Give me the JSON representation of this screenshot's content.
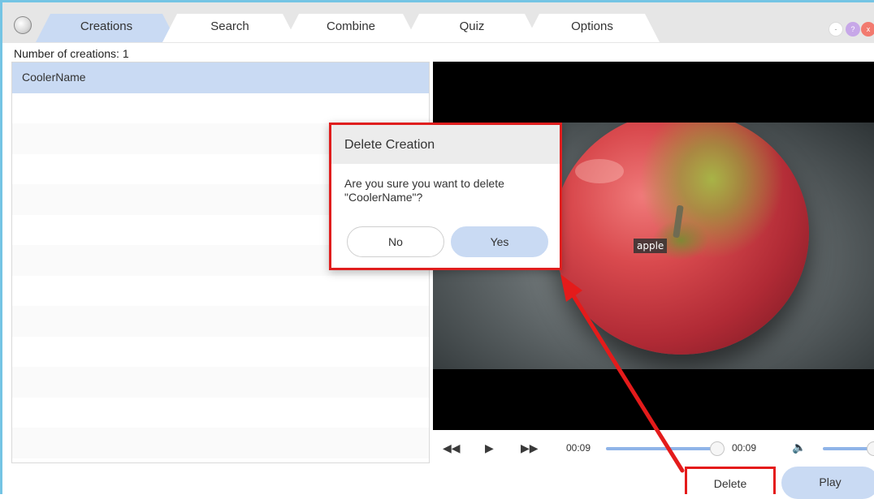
{
  "tabs": [
    {
      "label": "Creations",
      "active": true
    },
    {
      "label": "Search",
      "active": false
    },
    {
      "label": "Combine",
      "active": false
    },
    {
      "label": "Quiz",
      "active": false
    },
    {
      "label": "Options",
      "active": false
    }
  ],
  "window_controls": {
    "minimize": "-",
    "help": "?",
    "close": "x"
  },
  "creations_count_label": "Number of creations: 1",
  "creations_list": {
    "items": [
      "CoolerName"
    ],
    "selected_index": 0
  },
  "video": {
    "caption": "apple",
    "current_time": "00:09",
    "total_time": "00:09",
    "progress": 1.0,
    "volume": 1.0
  },
  "dialog": {
    "title": "Delete Creation",
    "message": "Are you sure you want to delete \"CoolerName\"?",
    "no_label": "No",
    "yes_label": "Yes"
  },
  "actions": {
    "delete_label": "Delete",
    "play_label": "Play"
  },
  "colors": {
    "accent": "#c9daf3",
    "frame": "#74c4e4",
    "annotation": "#e41b1b"
  },
  "icons": {
    "rewind": "◀◀",
    "play": "▶",
    "forward": "▶▶",
    "volume": "🔈"
  }
}
